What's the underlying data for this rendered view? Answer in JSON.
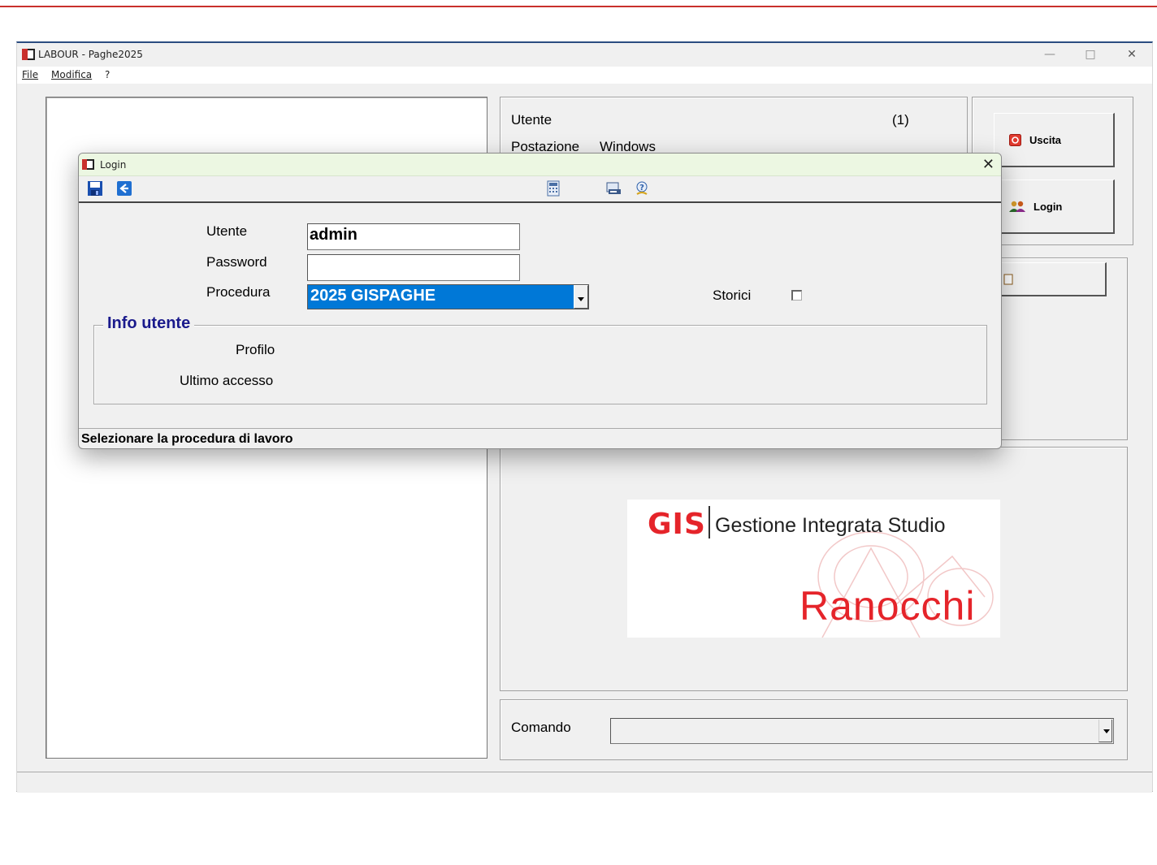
{
  "window": {
    "title": "LABOUR - Paghe2025",
    "controls": {
      "minimize": "—",
      "maximize": "□",
      "close": "✕"
    }
  },
  "menu": {
    "file": "File",
    "modifica": "Modifica",
    "help": "?"
  },
  "info": {
    "utente_label": "Utente",
    "utente_value": "(1)",
    "postazione_label": "Postazione",
    "postazione_value": "Windows"
  },
  "buttons": {
    "uscita": "Uscita",
    "login": "Login"
  },
  "logo": {
    "brand": "GIS",
    "tagline": "Gestione Integrata Studio",
    "company": "Ranocchi",
    "brand_color": "#e5242a"
  },
  "comando": {
    "label": "Comando",
    "value": ""
  },
  "login_dialog": {
    "title": "Login",
    "close": "✕",
    "toolbar_icons": [
      "save-icon",
      "back-arrow-icon",
      "calculator-icon",
      "print-icon",
      "help-icon"
    ],
    "utente_label": "Utente",
    "utente_value": "admin",
    "password_label": "Password",
    "password_value": "",
    "procedura_label": "Procedura",
    "procedura_value": "2025 GISPAGHE",
    "storici_label": "Storici",
    "storici_checked": false,
    "info_group_title": "Info utente",
    "profilo_label": "Profilo",
    "ultimo_accesso_label": "Ultimo accesso",
    "status_text": "Selezionare la procedura di lavoro",
    "selection_color": "#0078d7"
  }
}
